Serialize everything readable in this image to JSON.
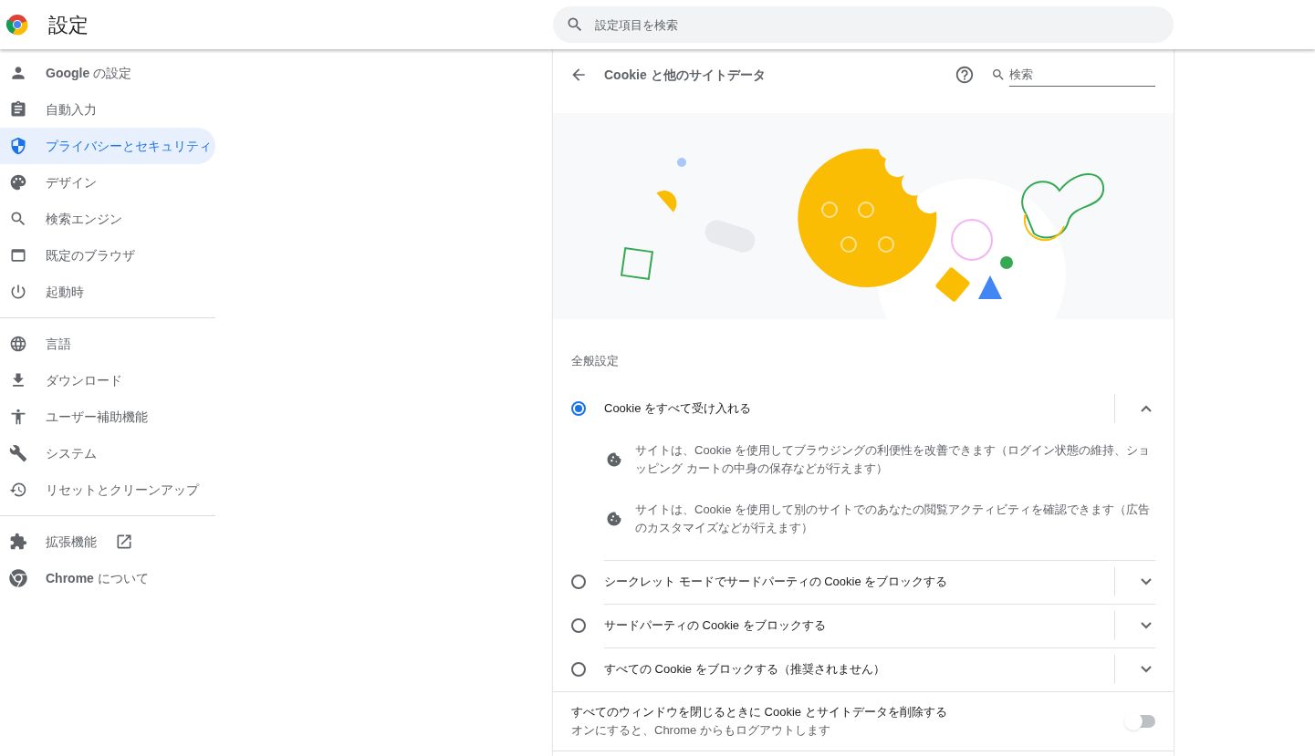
{
  "header": {
    "title": "設定",
    "search": {
      "placeholder": "設定項目を検索"
    }
  },
  "sidebar": {
    "groups": [
      {
        "items": [
          {
            "label": "**Google** の設定",
            "selected": false,
            "kind": "page"
          },
          {
            "label": "自動入力",
            "selected": false,
            "kind": "page"
          },
          {
            "label": "プライバシーとセキュリティ",
            "selected": true,
            "kind": "page"
          },
          {
            "label": "デザイン",
            "selected": false,
            "kind": "page"
          },
          {
            "label": "検索エンジン",
            "selected": false,
            "kind": "page"
          },
          {
            "label": "既定のブラウザ",
            "selected": false,
            "kind": "page"
          },
          {
            "label": "起動時",
            "selected": false,
            "kind": "page"
          }
        ]
      },
      {
        "items": [
          {
            "label": "言語",
            "selected": false,
            "kind": "page"
          },
          {
            "label": "ダウンロード",
            "selected": false,
            "kind": "page"
          },
          {
            "label": "ユーザー補助機能",
            "selected": false,
            "kind": "page"
          },
          {
            "label": "システム",
            "selected": false,
            "kind": "page"
          },
          {
            "label": "リセットとクリーンアップ",
            "selected": false,
            "kind": "page"
          }
        ]
      },
      {
        "items": [
          {
            "label": "拡張機能",
            "selected": false,
            "kind": "external"
          },
          {
            "label": "**Chrome** について",
            "selected": false,
            "kind": "page"
          }
        ]
      }
    ]
  },
  "page": {
    "title": "Cookie と他のサイトデータ",
    "search": {
      "placeholder": "検索"
    },
    "section_title": "全般設定",
    "options": [
      {
        "label": "Cookie をすべて受け入れる",
        "selected": true,
        "expanded": true,
        "details": [
          "サイトは、Cookie を使用してブラウジングの利便性を改善できます（ログイン状態の維持、ショッピング カートの中身の保存などが行えます）",
          "サイトは、Cookie を使用して別のサイトでのあなたの閲覧アクティビティを確認できます（広告のカスタマイズなどが行えます）"
        ]
      },
      {
        "label": "シークレット モードでサードパーティの Cookie をブロックする",
        "selected": false,
        "expanded": false
      },
      {
        "label": "サードパーティの Cookie をブロックする",
        "selected": false,
        "expanded": false
      },
      {
        "label": "すべての Cookie をブロックする（推奨されません）",
        "selected": false,
        "expanded": false
      }
    ],
    "toggle": {
      "label": "すべてのウィンドウを閉じるときに Cookie とサイトデータを削除する",
      "description": "オンにすると、Chrome からもログアウトします",
      "on": false
    }
  }
}
